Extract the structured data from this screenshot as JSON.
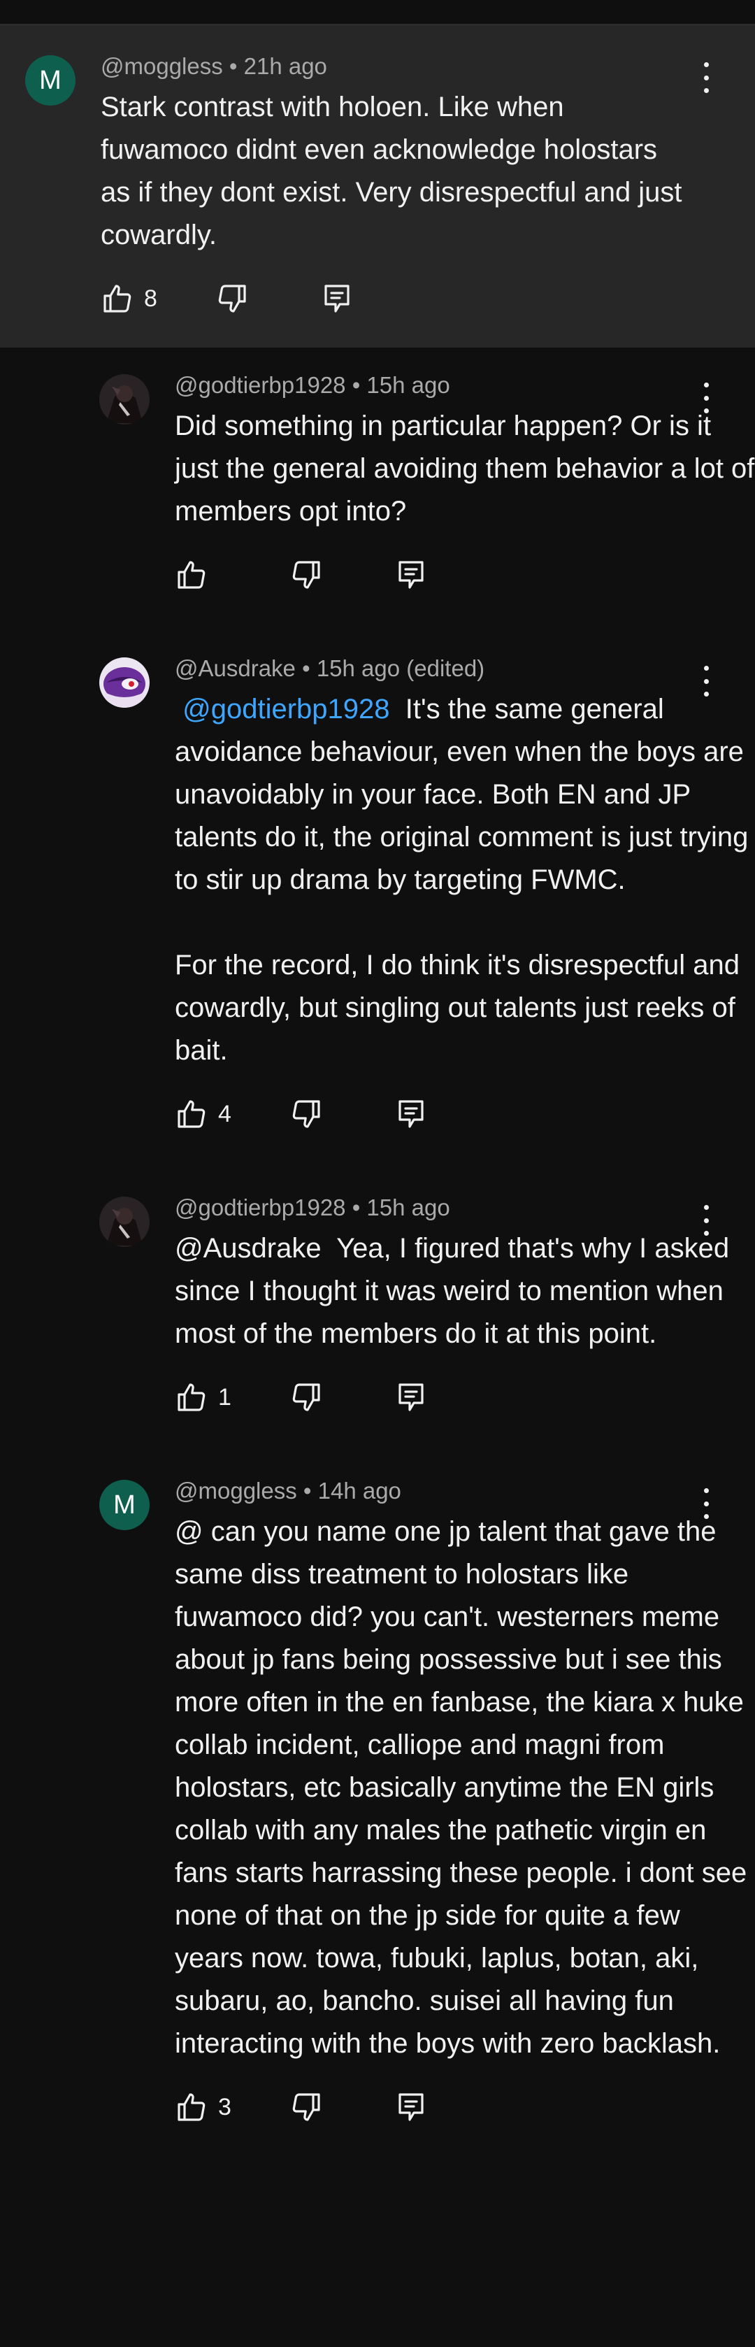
{
  "comments": [
    {
      "author": "@moggless",
      "time": "21h ago",
      "edited": "",
      "avatar_letter": "M",
      "avatar_color": "#0f5f4f",
      "mention": "",
      "text": "Stark contrast with holoen. Like when fuwamoco didnt even acknowledge holostars as if they dont exist. Very disrespectful and just cowardly.",
      "likes": "8"
    },
    {
      "author": "@godtierbp1928",
      "time": "15h ago",
      "edited": "",
      "avatar_icon": "dark-character-avatar-icon",
      "mention": "",
      "text": "Did something in particular happen? Or is it just the general avoiding them behavior a lot of members opt into?",
      "likes": ""
    },
    {
      "author": "@Ausdrake",
      "time": "15h ago",
      "edited": "(edited)",
      "avatar_icon": "purple-mask-avatar-icon",
      "mention": "@godtierbp1928",
      "text": "It's the same general avoidance behaviour, even when the boys are unavoidably in your face. Both EN and JP talents do it, the original comment is just trying to stir up drama by targeting FWMC.\n\nFor the record, I do think it's disrespectful and cowardly, but singling out talents just reeks of bait.",
      "likes": "4"
    },
    {
      "author": "@godtierbp1928",
      "time": "15h ago",
      "edited": "",
      "avatar_icon": "dark-character-avatar-icon",
      "mention": "",
      "text": "@Ausdrake  Yea, I figured that's why I asked since I thought it was weird to mention when most of the members do it at this point.",
      "likes": "1"
    },
    {
      "author": "@moggless",
      "time": "14h ago",
      "edited": "",
      "avatar_letter": "M",
      "avatar_color": "#0f5f4f",
      "mention": "",
      "text": "@ can you name one jp talent that gave the same diss treatment to holostars like fuwamoco did? you can't. westerners meme about jp fans being possessive but i see this more often in the en fanbase, the kiara x huke collab incident, calliope and magni from holostars, etc basically anytime the EN girls collab with any males the pathetic virgin en fans starts harrassing these people. i dont see none of that on the jp side for quite a few years now. towa, fubuki, laplus, botan, aki, subaru, ao, bancho. suisei all having fun interacting with the boys with zero backlash.",
      "likes": "3"
    }
  ]
}
